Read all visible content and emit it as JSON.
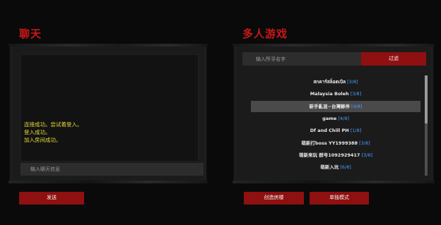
{
  "chat": {
    "title": "聊天",
    "log_lines": [
      "连接成功。尝试着登入。",
      "登入成功。",
      "加入房间成功。"
    ],
    "input_placeholder": "输入聊天信息",
    "send_label": "发送",
    "log_text_color": "#e6d93a"
  },
  "multiplayer": {
    "title": "多人游戏",
    "search_placeholder": "输入所寻名字",
    "filter_label": "过滤",
    "selected_index": 2,
    "servers": [
      {
        "name": "สกคาร์สล็อตเบิล",
        "count": "[3/8]"
      },
      {
        "name": "Malaysia Boleh",
        "count": "[3/8]"
      },
      {
        "name": "新手亂混~台灣夥伴",
        "count": "[4/8]"
      },
      {
        "name": "game",
        "count": "[4/8]"
      },
      {
        "name": "Df and Chill PH",
        "count": "[1/8]"
      },
      {
        "name": "萌新打boss YY1999388",
        "count": "[3/8]"
      },
      {
        "name": "萌新来玩 群号1092929417",
        "count": "[3/8]"
      },
      {
        "name": "萌新入坑",
        "count": "[6/8]"
      }
    ],
    "create_room_label": "创造房楼",
    "solo_mode_label": "单独模式"
  },
  "colors": {
    "accent_red": "#c81818",
    "button_red": "#8f1010",
    "player_count_blue": "#4aa0ff",
    "panel_bg": "#1b1b1b",
    "page_bg": "#0a0a0a"
  }
}
